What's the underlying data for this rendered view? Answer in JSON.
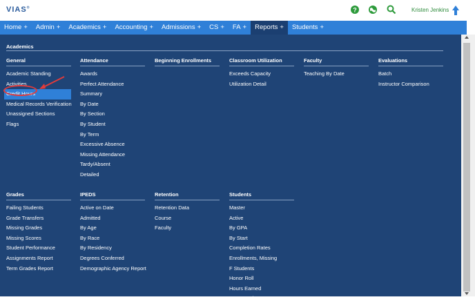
{
  "app": {
    "logo": "VIAS",
    "logo_mark": "®",
    "user": "Kristen Jenkins"
  },
  "icons": [
    "help-icon",
    "globe-icon",
    "search-icon",
    "upload-icon"
  ],
  "colors": {
    "nav": "#2f80d8",
    "panel": "#1f4476",
    "accent_green": "#2e8b3c",
    "annotation": "#e23b3b"
  },
  "nav": [
    {
      "label": "Home",
      "plus": "+"
    },
    {
      "label": "Admin",
      "plus": "+"
    },
    {
      "label": "Academics",
      "plus": "+"
    },
    {
      "label": "Accounting",
      "plus": "+"
    },
    {
      "label": "Admissions",
      "plus": "+"
    },
    {
      "label": "CS",
      "plus": "+"
    },
    {
      "label": "FA",
      "plus": "+"
    },
    {
      "label": "Reports",
      "plus": "+",
      "active": true
    },
    {
      "label": "Students",
      "plus": "+"
    }
  ],
  "menu": {
    "section": "Academics",
    "columns": [
      {
        "heading": "General",
        "links": [
          "Academic Standing",
          "Activities",
          "Credit Hours",
          "Medical Records Verification",
          "Unassigned Sections",
          "Flags"
        ],
        "selected": 2
      },
      {
        "heading": "Attendance",
        "links": [
          "Awards",
          "Perfect Attendance",
          "Summary",
          "By Date",
          "By Section",
          "By Student",
          "By Term",
          "Excessive Absence",
          "Missing Attendance",
          "Tardy/Absent",
          "Detailed"
        ]
      },
      {
        "heading": "Beginning Enrollments",
        "links": []
      },
      {
        "heading": "Classroom Utilization",
        "links": [
          "Exceeds Capacity",
          "Utilization Detail"
        ]
      },
      {
        "heading": "Faculty",
        "links": [
          "Teaching By Date"
        ]
      },
      {
        "heading": "Evaluations",
        "links": [
          "Batch",
          "Instructor Comparison"
        ]
      },
      {
        "heading": "Grades",
        "links": [
          "Failing Students",
          "Grade Transfers",
          "Missing Grades",
          "Missing Scores",
          "Student Performance",
          "Assignments Report",
          "Term Grades Report"
        ]
      },
      {
        "heading": "IPEDS",
        "links": [
          "Active on Date",
          "Admitted",
          "By Age",
          "By Race",
          "By Residency",
          "Degrees Conferred",
          "Demographic Agency Report"
        ]
      },
      {
        "heading": "Retention",
        "links": [
          "Retention Data",
          "Course",
          "Faculty"
        ]
      },
      {
        "heading": "Students",
        "links": [
          "Master",
          "Active",
          "By GPA",
          "By Start",
          "Completion Rates",
          "Enrollments, Missing",
          "F Students",
          "Honor Roll",
          "Hours Earned",
          "Hours Ratio"
        ]
      }
    ]
  }
}
